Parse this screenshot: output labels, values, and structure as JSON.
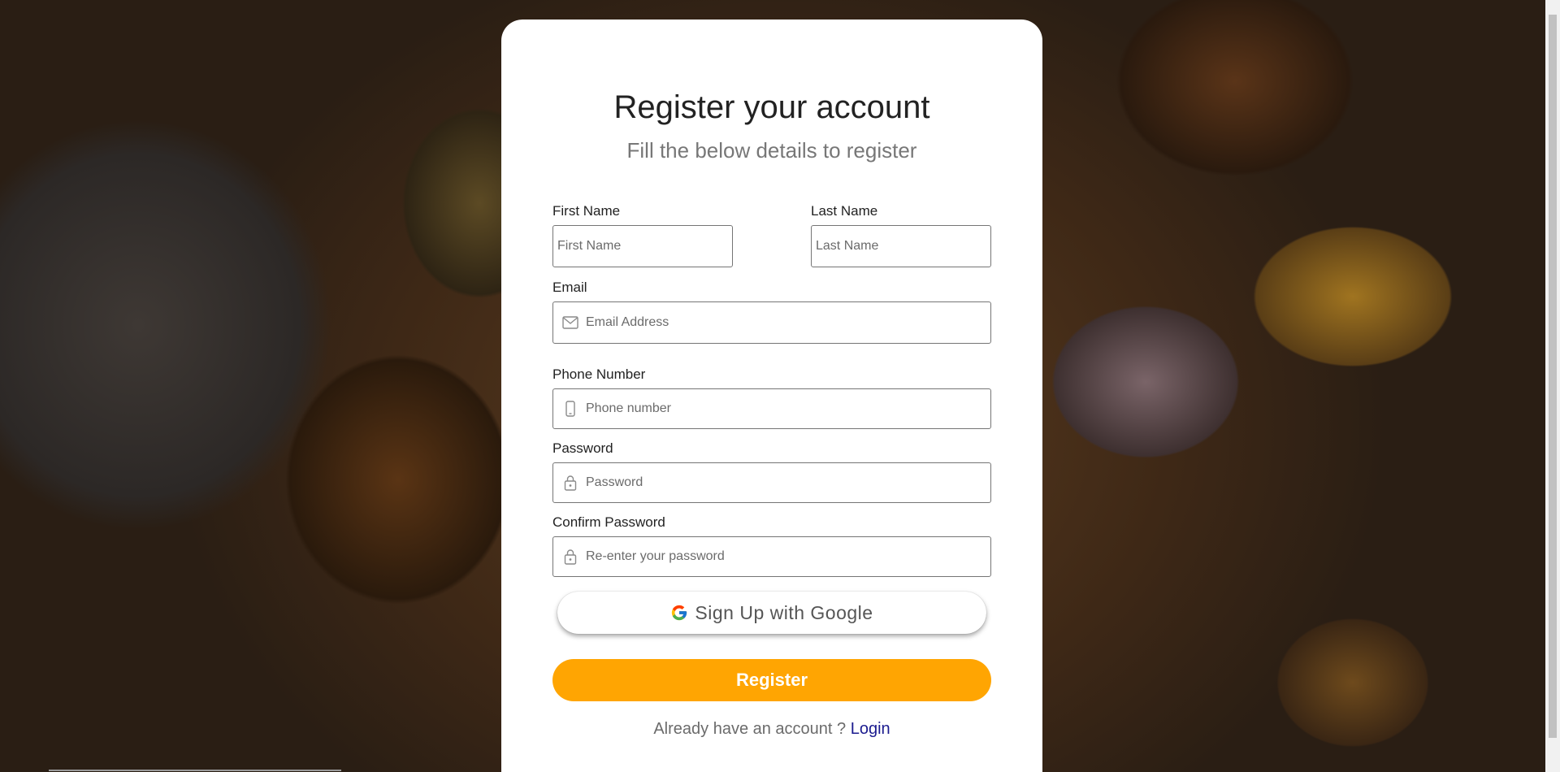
{
  "form": {
    "title": "Register your account",
    "subtitle": "Fill the below details to register"
  },
  "fields": {
    "first_name": {
      "label": "First Name",
      "placeholder": "First Name",
      "value": ""
    },
    "last_name": {
      "label": "Last Name",
      "placeholder": "Last Name",
      "value": ""
    },
    "email": {
      "label": "Email",
      "placeholder": "Email Address",
      "value": "",
      "icon": "envelope-icon"
    },
    "phone": {
      "label": "Phone Number",
      "placeholder": "Phone number",
      "value": "",
      "icon": "phone-icon"
    },
    "password": {
      "label": "Password",
      "placeholder": "Password",
      "value": "",
      "icon": "lock-icon"
    },
    "confirm_password": {
      "label": "Confirm Password",
      "placeholder": "Re-enter your password",
      "value": "",
      "icon": "lock-icon"
    }
  },
  "buttons": {
    "google": {
      "label": "Sign Up with Google",
      "icon": "google-icon"
    },
    "register": {
      "label": "Register"
    }
  },
  "footer": {
    "prompt": "Already have an account ?",
    "login_link": "Login"
  },
  "colors": {
    "accent": "#ffa502",
    "link": "#1b1b8f",
    "card": "#ffffff"
  }
}
